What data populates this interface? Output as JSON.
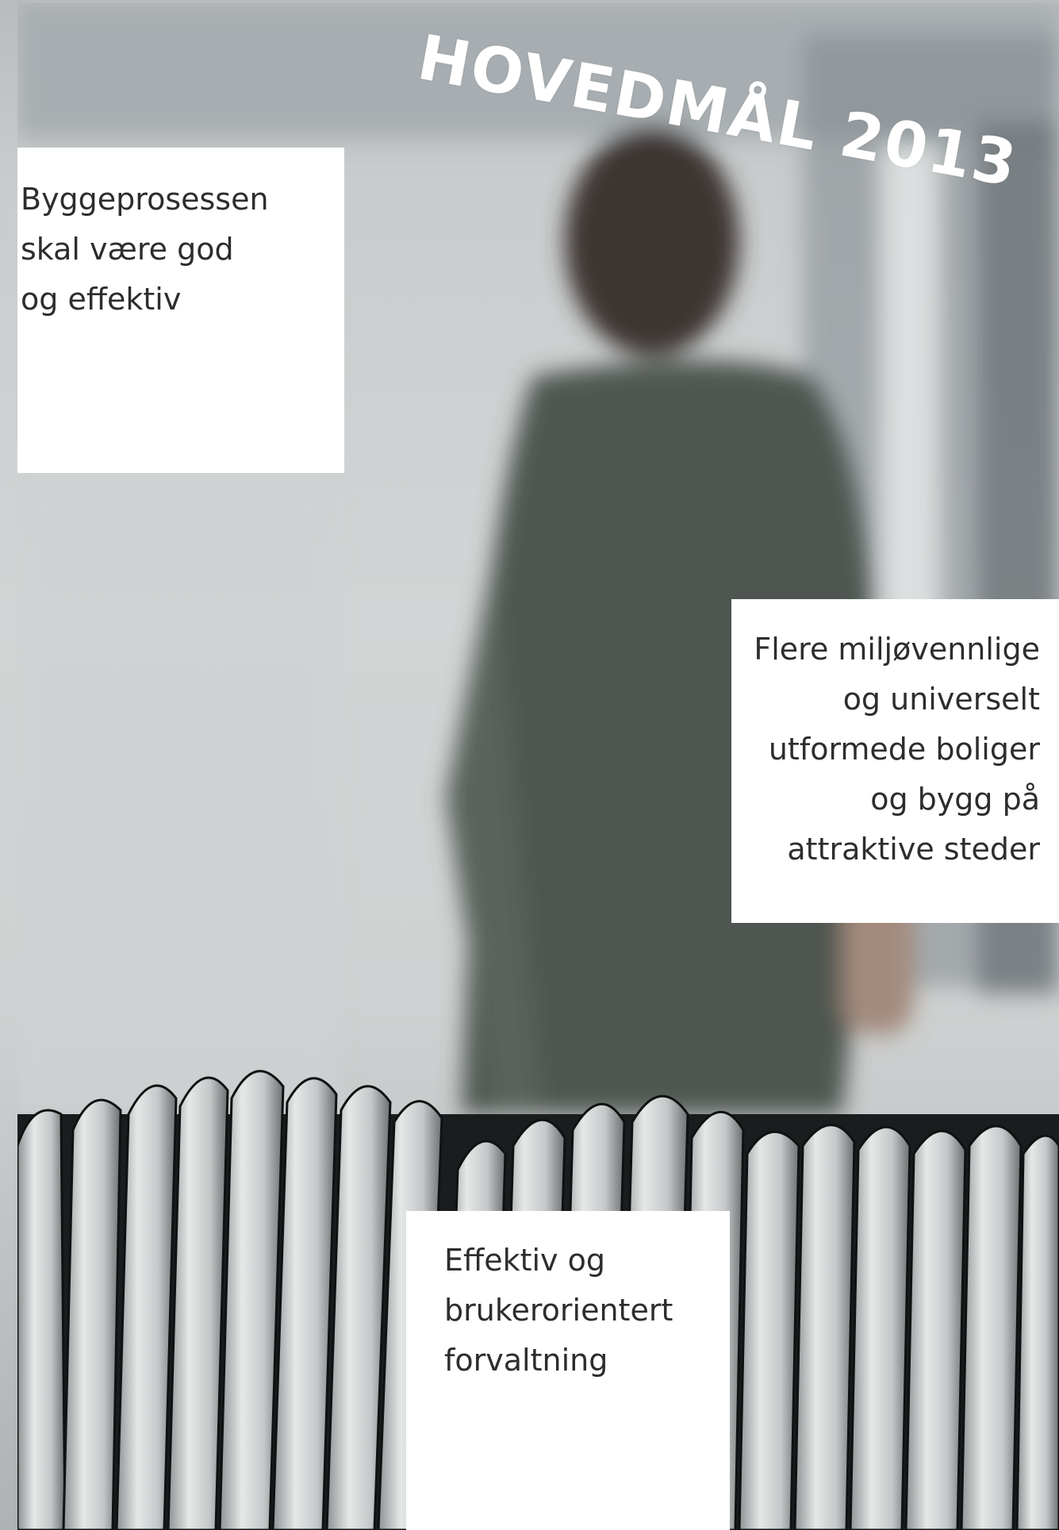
{
  "heading": "HOVEDMÅL 2013",
  "goals": [
    {
      "lines": [
        "Byggeprosessen",
        "skal være god",
        "og effektiv"
      ]
    },
    {
      "lines": [
        "Flere miljøvennlige",
        "og universelt",
        "utformede boliger",
        "og bygg på",
        "attraktive steder"
      ]
    },
    {
      "lines": [
        "Effektiv og",
        "brukerorientert",
        "forvaltning"
      ]
    }
  ],
  "photo": {
    "subject": "person-standing-and-cable-coils",
    "colors": {
      "background": "#cfd2d2",
      "shirt": "#4f5751",
      "hair": "#3c3631",
      "cable_light": "#d9dcdc",
      "cable_dark": "#1a1c1d"
    }
  }
}
